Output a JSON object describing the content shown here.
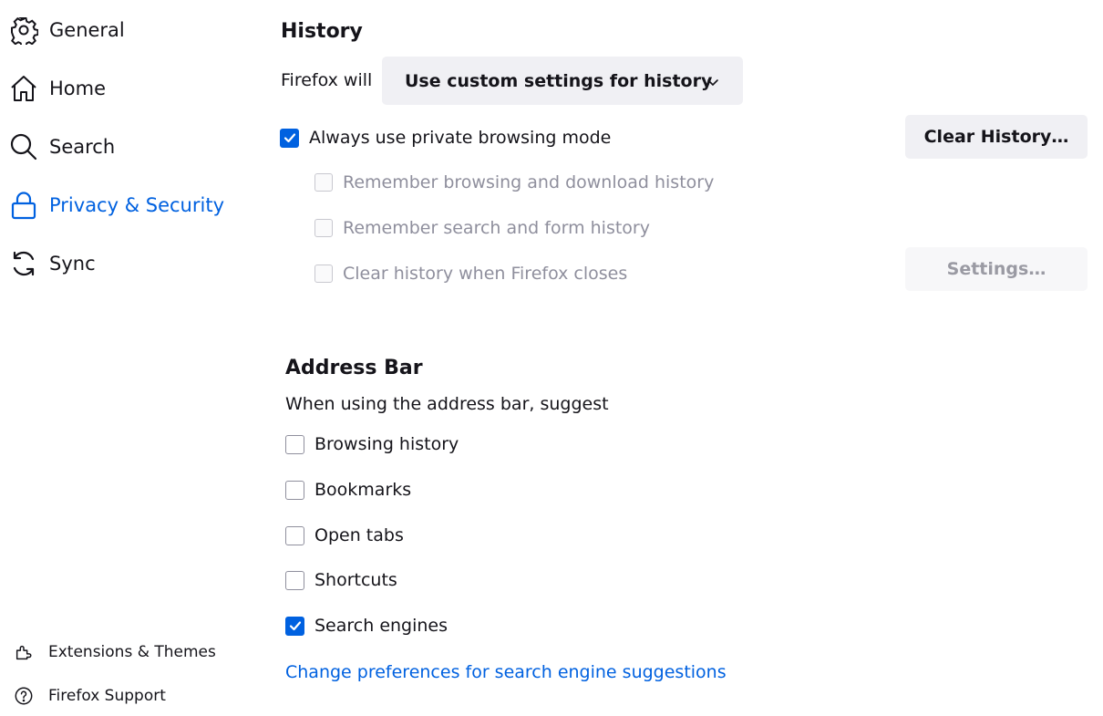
{
  "sidebar": {
    "items": [
      {
        "label": "General",
        "icon": "gear-icon"
      },
      {
        "label": "Home",
        "icon": "home-icon"
      },
      {
        "label": "Search",
        "icon": "search-icon"
      },
      {
        "label": "Privacy & Security",
        "icon": "lock-icon",
        "selected": true
      },
      {
        "label": "Sync",
        "icon": "sync-icon"
      }
    ],
    "footer": [
      {
        "label": "Extensions & Themes",
        "icon": "puzzle-icon"
      },
      {
        "label": "Firefox Support",
        "icon": "help-icon"
      }
    ],
    "accent_color": "#0061e0"
  },
  "history": {
    "title": "History",
    "firefox_will_label": "Firefox will",
    "dropdown_value": "Use custom settings for history",
    "clear_history_button": "Clear History…",
    "settings_button": "Settings…",
    "options": [
      {
        "label": "Always use private browsing mode",
        "checked": true,
        "disabled": false
      },
      {
        "label": "Remember browsing and download history",
        "checked": false,
        "disabled": true
      },
      {
        "label": "Remember search and form history",
        "checked": false,
        "disabled": true
      },
      {
        "label": "Clear history when Firefox closes",
        "checked": false,
        "disabled": true
      }
    ]
  },
  "address_bar": {
    "title": "Address Bar",
    "description": "When using the address bar, suggest",
    "options": [
      {
        "label": "Browsing history",
        "checked": false
      },
      {
        "label": "Bookmarks",
        "checked": false
      },
      {
        "label": "Open tabs",
        "checked": false
      },
      {
        "label": "Shortcuts",
        "checked": false
      },
      {
        "label": "Search engines",
        "checked": true
      }
    ],
    "change_prefs_link": "Change preferences for search engine suggestions"
  }
}
